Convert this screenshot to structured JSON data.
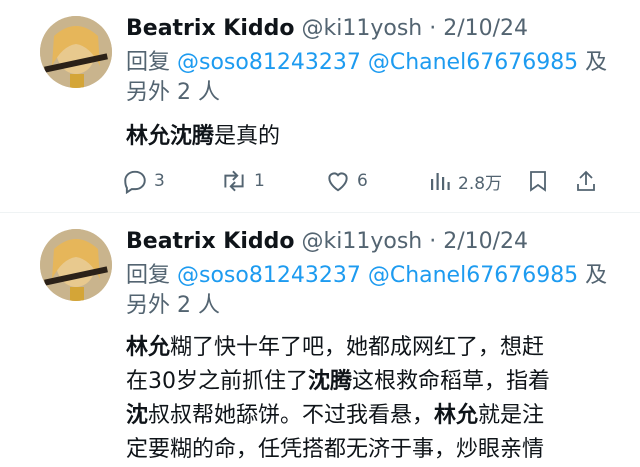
{
  "tweets": [
    {
      "author_name": "Beatrix Kiddo",
      "handle": "@ki11yosh",
      "separator": " · ",
      "date": "2/10/24",
      "reply_prefix": "回复 ",
      "mention1": "@soso81243237",
      "mention2": "@Chanel67676985",
      "reply_suffix1": " 及",
      "reply_suffix2": "另外 2 人",
      "body": {
        "part1_bold": "林允沈腾",
        "part2": "是真的"
      },
      "replies": "3",
      "retweets": "1",
      "likes": "6",
      "views": "2.8万"
    },
    {
      "author_name": "Beatrix Kiddo",
      "handle": "@ki11yosh",
      "separator": " · ",
      "date": "2/10/24",
      "reply_prefix": "回复 ",
      "mention1": "@soso81243237",
      "mention2": "@Chanel67676985",
      "reply_suffix1": " 及",
      "reply_suffix2": "另外 2 人",
      "body": {
        "l1_b1": "林允",
        "l1_t1": "糊了快十年了吧，她都成网红了，想赶",
        "l2_t1": "在30岁之前抓住了",
        "l2_b1": "沈腾",
        "l2_t2": "这根救命稻草，指着",
        "l3_b1": "沈",
        "l3_t1": "叔叔帮她舔饼。不过我看悬，",
        "l3_b2": "林允",
        "l3_t2": "就是注",
        "l4_t1": "定要糊的命，任凭搭都无济于事，炒眼亲情"
      }
    }
  ],
  "colors": {
    "text": "#0f1419",
    "secondary": "#536471",
    "link": "#1d9bf0"
  },
  "icons": [
    "avatar",
    "reply-icon",
    "retweet-icon",
    "like-icon",
    "views-icon",
    "bookmark-icon",
    "share-icon"
  ]
}
